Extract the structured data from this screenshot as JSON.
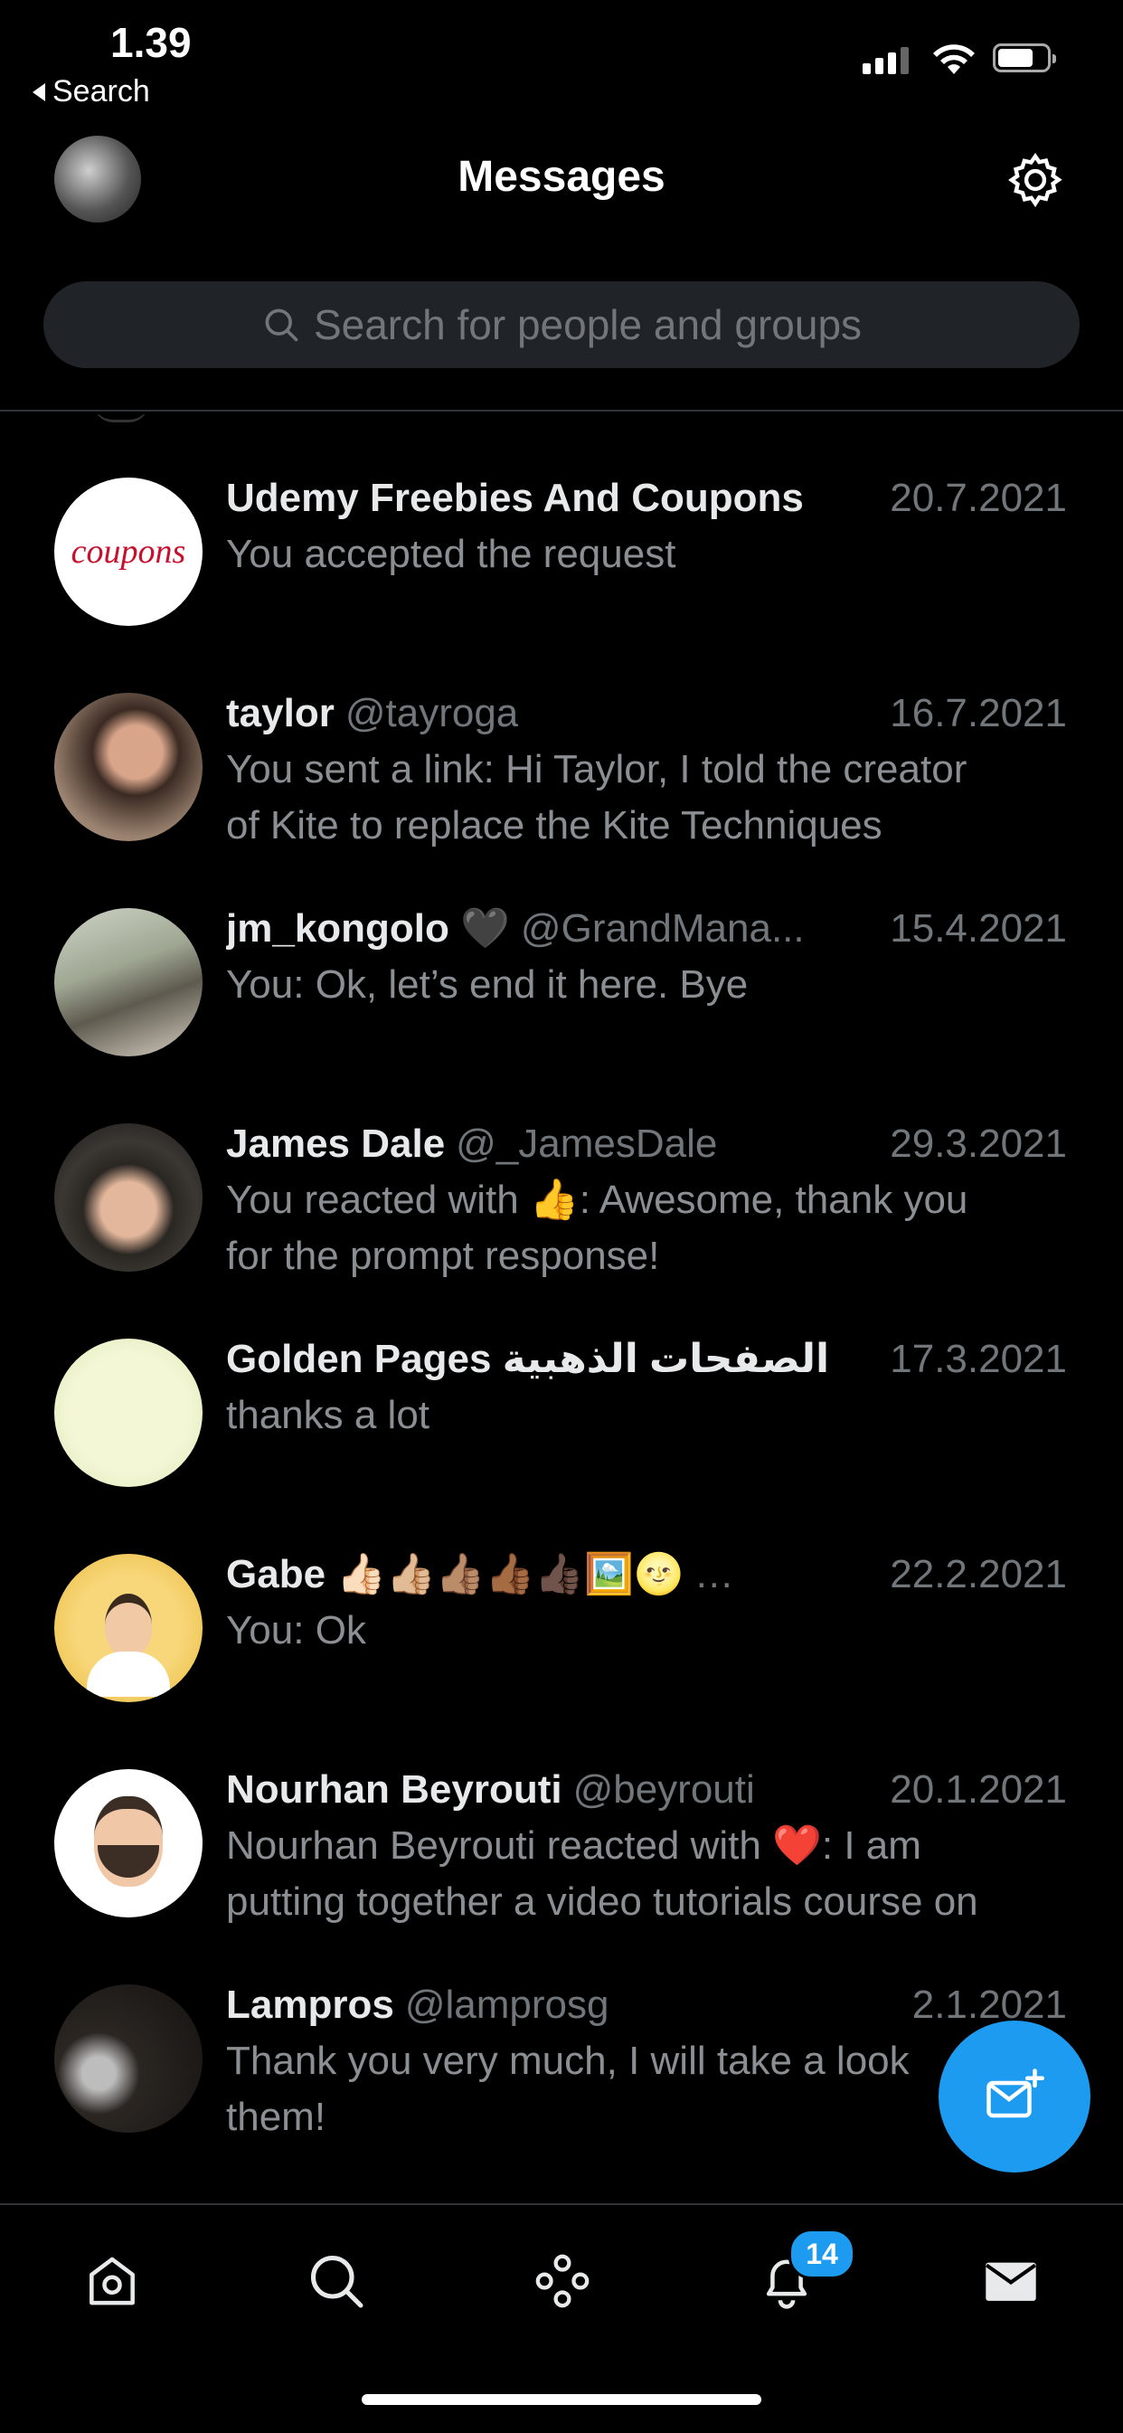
{
  "status": {
    "time": "1.39",
    "back_label": "Search"
  },
  "header": {
    "title": "Messages"
  },
  "search": {
    "placeholder": "Search for people and groups"
  },
  "conversations": [
    {
      "name": "Udemy Freebies And Coupons",
      "handle": "",
      "date": "20.7.2021",
      "preview": [
        "You accepted the request"
      ],
      "avatar": "coupons"
    },
    {
      "name": "taylor",
      "handle": "@tayroga",
      "date": "16.7.2021",
      "preview": [
        "You sent a link: Hi Taylor, I told the creator",
        "of Kite to replace the Kite Techniques"
      ],
      "avatar": "photo"
    },
    {
      "name": "jm_kongolo 🖤",
      "handle": "@GrandMana...",
      "date": "15.4.2021",
      "preview": [
        "You: Ok, let’s end it here. Bye"
      ],
      "avatar": "photo"
    },
    {
      "name": "James Dale",
      "handle": "@_JamesDale",
      "date": "29.3.2021",
      "preview": [
        "You reacted with 👍: Awesome, thank you",
        "for the prompt response!"
      ],
      "avatar": "photo"
    },
    {
      "name": "Golden Pages الصفحات الذهبية",
      "handle": "",
      "date": "17.3.2021",
      "preview": [
        "thanks a lot"
      ],
      "avatar": "arabic"
    },
    {
      "name": "Gabe 👍🏻👍🏼👍🏽👍🏾👍🏿🖼️🌝",
      "handle": "…",
      "date": "22.2.2021",
      "preview": [
        "You: Ok"
      ],
      "avatar": "cartoon"
    },
    {
      "name": "Nourhan Beyrouti",
      "handle": "@beyrouti",
      "date": "20.1.2021",
      "preview": [
        "Nourhan Beyrouti reacted with ❤️: I am",
        "putting together a video tutorials course on"
      ],
      "avatar": "memoji"
    },
    {
      "name": "Lampros",
      "handle": "@lamprosg",
      "date": "2.1.2021",
      "preview": [
        "Thank you very much, I will take a look",
        "them!"
      ],
      "avatar": "photo"
    }
  ],
  "tabbar": {
    "notifications_count": "14"
  },
  "colors": {
    "accent": "#1d9bf0",
    "background": "#000000",
    "secondary_text": "#71767b"
  }
}
